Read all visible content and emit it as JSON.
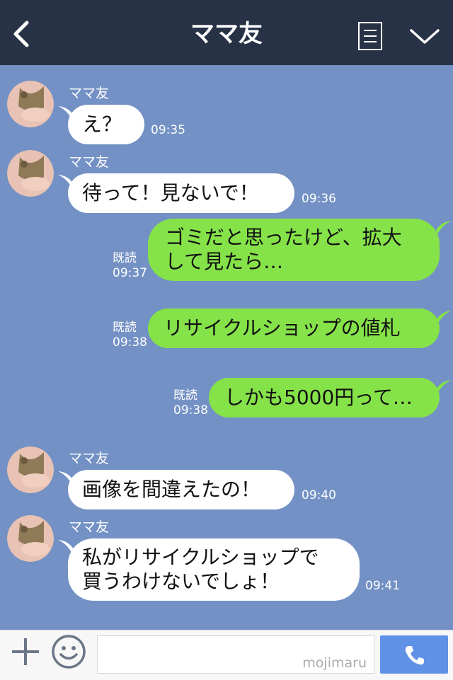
{
  "header": {
    "title": "ママ友",
    "back_icon": "chevron-left-icon",
    "menu_icon": "list-icon",
    "dropdown_icon": "chevron-down-icon",
    "bg_color": "#273246"
  },
  "chat": {
    "bg_color": "#7391c4",
    "incoming_color": "#ffffff",
    "outgoing_color": "#85e249",
    "messages": [
      {
        "from": "ママ友",
        "lines": [
          "え？"
        ],
        "time": "09:35"
      },
      {
        "from": "ママ友",
        "lines": [
          "待って！見ないで！"
        ],
        "time": "09:36"
      },
      {
        "from": "me",
        "lines": [
          "ゴミだと思ったけど、拡大",
          "して見たら…"
        ],
        "read": "既読",
        "time": "09:37"
      },
      {
        "from": "me",
        "lines": [
          "リサイクルショップの値札"
        ],
        "read": "既読",
        "time": "09:38"
      },
      {
        "from": "me",
        "lines": [
          "しかも5000円って…"
        ],
        "read": "既読",
        "time": "09:38"
      },
      {
        "from": "ママ友",
        "lines": [
          "画像を間違えたの！"
        ],
        "time": "09:40"
      },
      {
        "from": "ママ友",
        "lines": [
          "私がリサイクルショップで",
          "買うわけないでしょ！"
        ],
        "time": "09:41"
      }
    ]
  },
  "footer": {
    "input_value": "",
    "watermark": "mojimaru",
    "plus_icon": "plus-icon",
    "emoji_icon": "smiley-icon",
    "call_icon": "phone-icon",
    "call_color": "#5f92e6"
  }
}
